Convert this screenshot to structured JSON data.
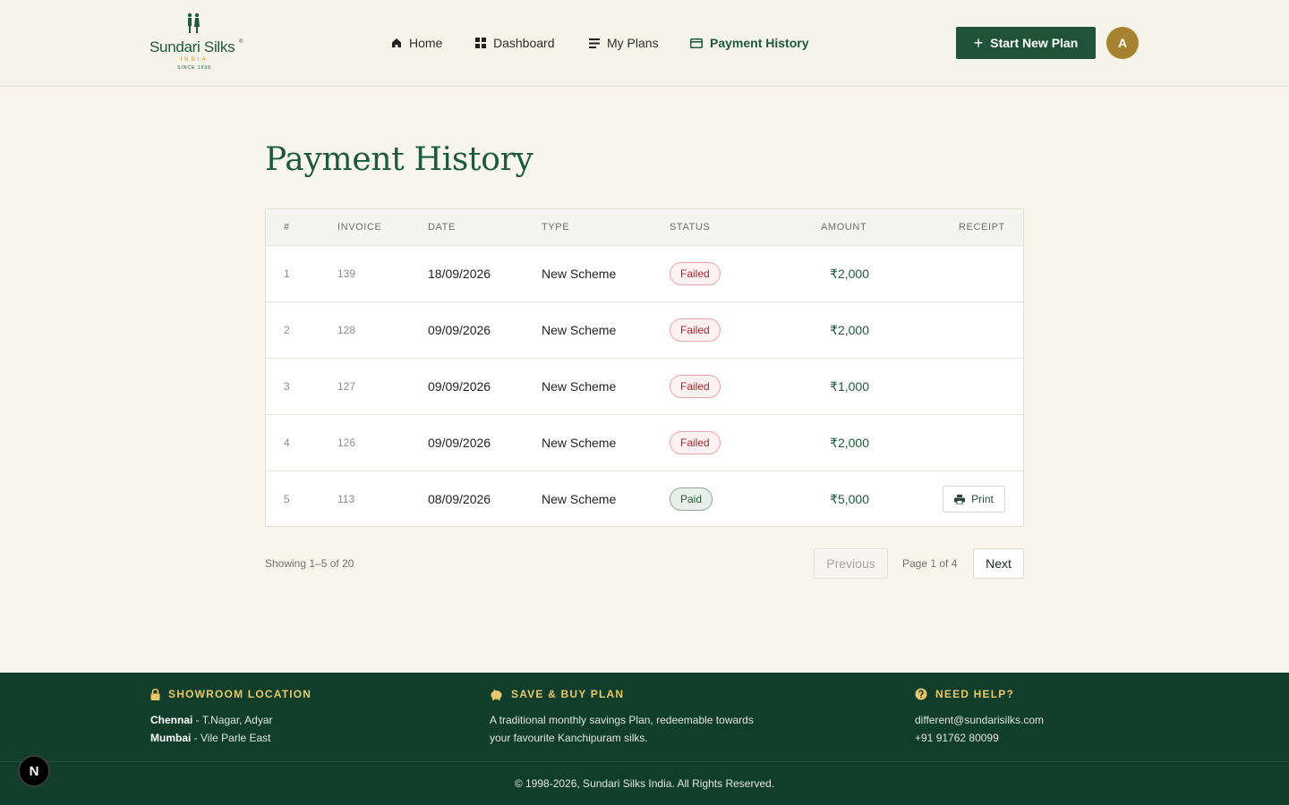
{
  "header": {
    "logo": {
      "name": "Sundari Silks",
      "registered": "®",
      "sub": "INDIA",
      "since": "SINCE 1998"
    },
    "nav": [
      {
        "label": "Home",
        "icon": "home-icon"
      },
      {
        "label": "Dashboard",
        "icon": "dashboard-icon"
      },
      {
        "label": "My Plans",
        "icon": "list-icon"
      },
      {
        "label": "Payment History",
        "icon": "card-icon"
      }
    ],
    "cta_label": "Start New Plan",
    "avatar_initial": "A"
  },
  "main": {
    "title": "Payment History",
    "table": {
      "columns": [
        "#",
        "INVOICE",
        "DATE",
        "TYPE",
        "STATUS",
        "AMOUNT",
        "RECEIPT"
      ],
      "rows": [
        {
          "num": "1",
          "invoice": "139",
          "date": "18/09/2026",
          "type": "New Scheme",
          "status": "Failed",
          "amount": "₹2,000",
          "receipt": ""
        },
        {
          "num": "2",
          "invoice": "128",
          "date": "09/09/2026",
          "type": "New Scheme",
          "status": "Failed",
          "amount": "₹2,000",
          "receipt": ""
        },
        {
          "num": "3",
          "invoice": "127",
          "date": "09/09/2026",
          "type": "New Scheme",
          "status": "Failed",
          "amount": "₹1,000",
          "receipt": ""
        },
        {
          "num": "4",
          "invoice": "126",
          "date": "09/09/2026",
          "type": "New Scheme",
          "status": "Failed",
          "amount": "₹2,000",
          "receipt": ""
        },
        {
          "num": "5",
          "invoice": "113",
          "date": "08/09/2026",
          "type": "New Scheme",
          "status": "Paid",
          "amount": "₹5,000",
          "receipt": "Print"
        }
      ]
    },
    "pagination": {
      "showing": "Showing 1–5 of 20",
      "previous": "Previous",
      "page_info": "Page 1 of 4",
      "next": "Next"
    }
  },
  "footer": {
    "showroom": {
      "heading": "SHOWROOM LOCATION",
      "locations": [
        {
          "city": "Chennai",
          "area": "T.Nagar, Adyar"
        },
        {
          "city": "Mumbai",
          "area": "Vile Parle East"
        }
      ]
    },
    "plan": {
      "heading": "SAVE & BUY PLAN",
      "line1": "A traditional monthly savings Plan, redeemable towards",
      "line2": "your favourite Kanchipuram silks."
    },
    "help": {
      "heading": "NEED HELP?",
      "email": "different@sundarisilks.com",
      "phone": "+91 91762 80099"
    },
    "copyright": "© 1998-2026, Sundari Silks India. All Rights Reserved."
  },
  "dev_badge": "N",
  "colors": {
    "brand_green": "#1d5a3a",
    "footer_green": "#113e2b",
    "gold": "#a68231",
    "footer_heading": "#e8c66a",
    "failed": "#a3262a",
    "paid": "#2c5e40"
  }
}
